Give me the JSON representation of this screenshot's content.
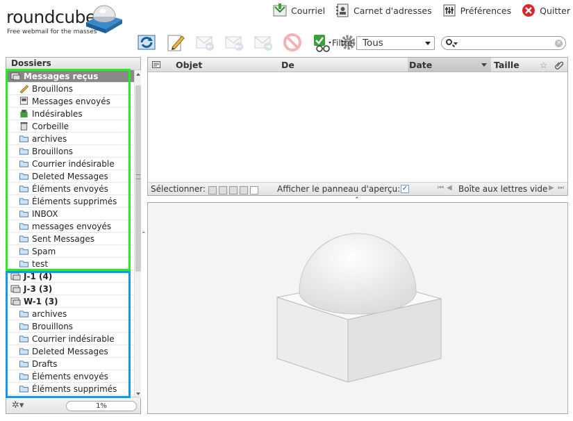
{
  "app": {
    "logo_word": "roundcube",
    "tagline": "Free webmail for the masses"
  },
  "topnav": [
    {
      "label": "Courriel",
      "icon": "mail-icon"
    },
    {
      "label": "Carnet d'adresses",
      "icon": "addressbook-icon"
    },
    {
      "label": "Préférences",
      "icon": "preferences-icon"
    },
    {
      "label": "Quitter",
      "icon": "logout-icon"
    }
  ],
  "toolbar": {
    "buttons": [
      {
        "name": "check-mail-button",
        "icon": "refresh-icon",
        "enabled": true
      },
      {
        "name": "compose-button",
        "icon": "pencil-icon",
        "enabled": true
      },
      {
        "name": "reply-button",
        "icon": "reply-icon",
        "enabled": false
      },
      {
        "name": "reply-all-button",
        "icon": "reply-all-icon",
        "enabled": false
      },
      {
        "name": "forward-button",
        "icon": "forward-icon",
        "enabled": false
      },
      {
        "name": "delete-button",
        "icon": "delete-icon",
        "enabled": false
      },
      {
        "name": "spam-button",
        "icon": "spam-icon",
        "enabled": true
      },
      {
        "name": "more-button",
        "icon": "gear-icon",
        "enabled": true
      }
    ]
  },
  "filter": {
    "label": "Filtre:",
    "value": "Tous"
  },
  "search": {
    "placeholder": ""
  },
  "folders": {
    "header": "Dossiers",
    "account1": {
      "name": "Messages reçus",
      "children": [
        {
          "label": "Brouillons",
          "icon": "drafts-icon"
        },
        {
          "label": "Messages envoyés",
          "icon": "sent-icon"
        },
        {
          "label": "Indésirables",
          "icon": "junk-icon"
        },
        {
          "label": "Corbeille",
          "icon": "trash-icon"
        },
        {
          "label": "archives",
          "icon": "folder-icon"
        },
        {
          "label": "Brouillons",
          "icon": "folder-icon"
        },
        {
          "label": "Courrier indésirable",
          "icon": "folder-icon"
        },
        {
          "label": "Deleted Messages",
          "icon": "folder-icon"
        },
        {
          "label": "Éléments envoyés",
          "icon": "folder-icon"
        },
        {
          "label": "Éléments supprimés",
          "icon": "folder-icon"
        },
        {
          "label": "INBOX",
          "icon": "folder-icon"
        },
        {
          "label": "messages envoyés",
          "icon": "folder-icon"
        },
        {
          "label": "Sent Messages",
          "icon": "folder-icon"
        },
        {
          "label": "Spam",
          "icon": "folder-icon"
        },
        {
          "label": "test",
          "icon": "folder-icon"
        }
      ]
    },
    "accounts": [
      {
        "label": "J-1 (4)"
      },
      {
        "label": "J-3 (3)"
      },
      {
        "label": "W-1 (3)"
      }
    ],
    "w1_children": [
      {
        "label": "archives"
      },
      {
        "label": "Brouillons"
      },
      {
        "label": "Courrier indésirable"
      },
      {
        "label": "Deleted Messages"
      },
      {
        "label": "Drafts"
      },
      {
        "label": "Éléments envoyés"
      },
      {
        "label": "Éléments supprimés"
      }
    ],
    "quota": "1%"
  },
  "messagelist": {
    "columns": {
      "subject": "Objet",
      "from": "De",
      "date": "Date",
      "size": "Taille"
    },
    "footer": {
      "select_label": "Sélectionner:",
      "preview_label": "Afficher le panneau d'aperçu:",
      "preview_checked": true,
      "count_text": "Boîte aux lettres vide"
    }
  }
}
